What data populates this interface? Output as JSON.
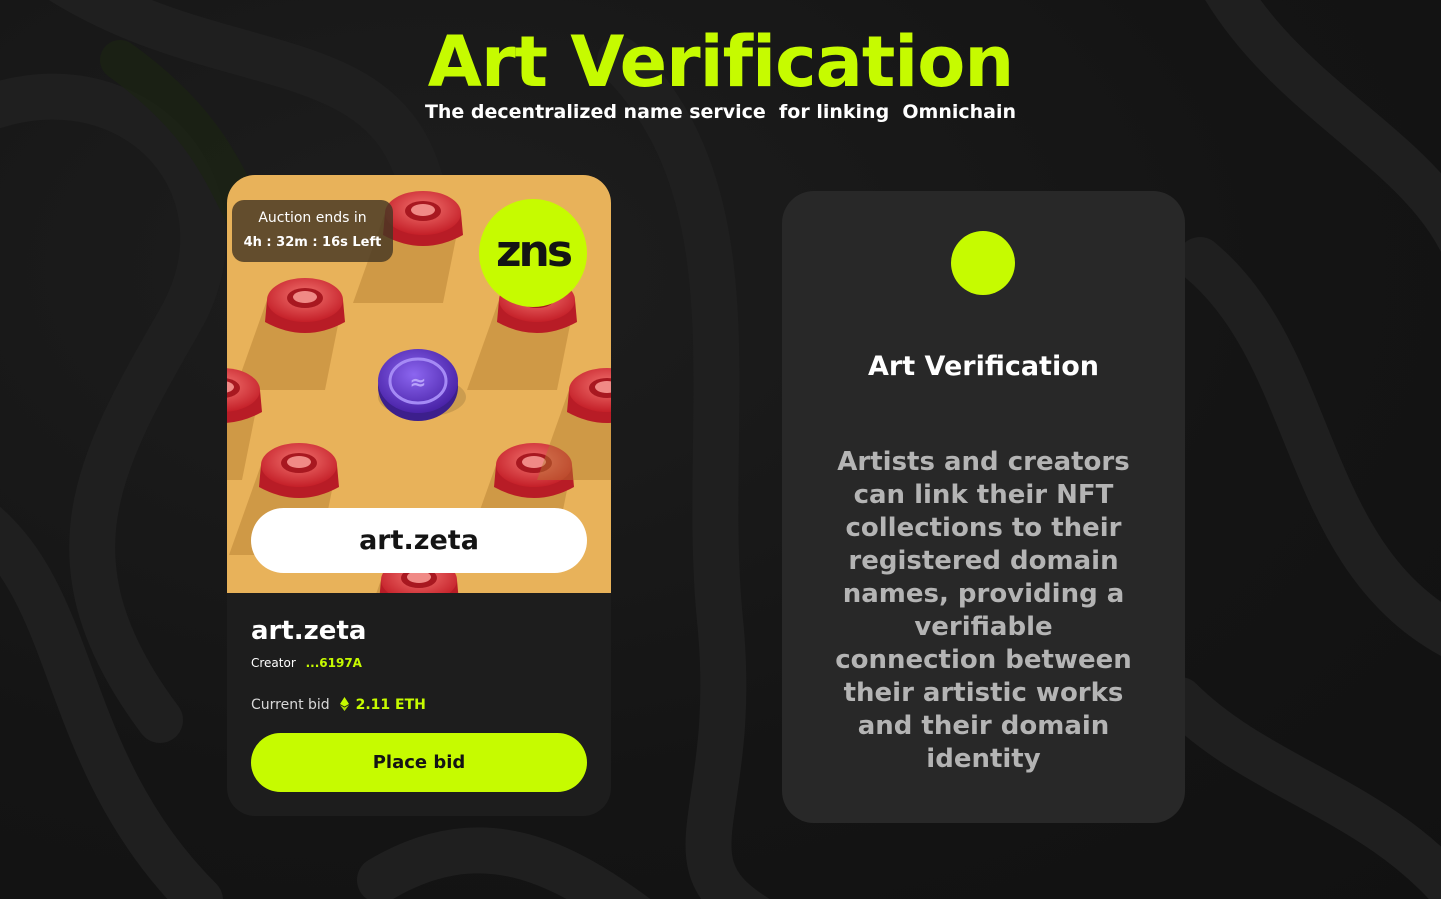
{
  "theme": {
    "accent": "#c6fb00",
    "background": "#151515",
    "card_background": "#1d1d1d",
    "info_card_background": "#282828",
    "image_background": "#e8b25a",
    "pieces_color": "#d6262f",
    "coin_color": "#6a3fd0"
  },
  "header": {
    "title": "Art Verification",
    "subtitle": "The decentralized name service  for linking  Omnichain"
  },
  "auction_card": {
    "timer_label": "Auction ends in",
    "timer_value": "4h : 32m : 16s Left",
    "logo_text": "zns",
    "domain_pill": "art.zeta",
    "name": "art.zeta",
    "creator_label": "Creator",
    "creator_address": "...6197A",
    "current_bid_label": "Current bid",
    "current_bid_icon": "ethereum-icon",
    "current_bid_value": "2.11 ETH",
    "place_bid_label": "Place bid"
  },
  "info_card": {
    "title": "Art Verification",
    "body": "Artists and creators can link their NFT collections to their registered domain names, providing a verifiable connection between their artistic works and their domain identity"
  }
}
